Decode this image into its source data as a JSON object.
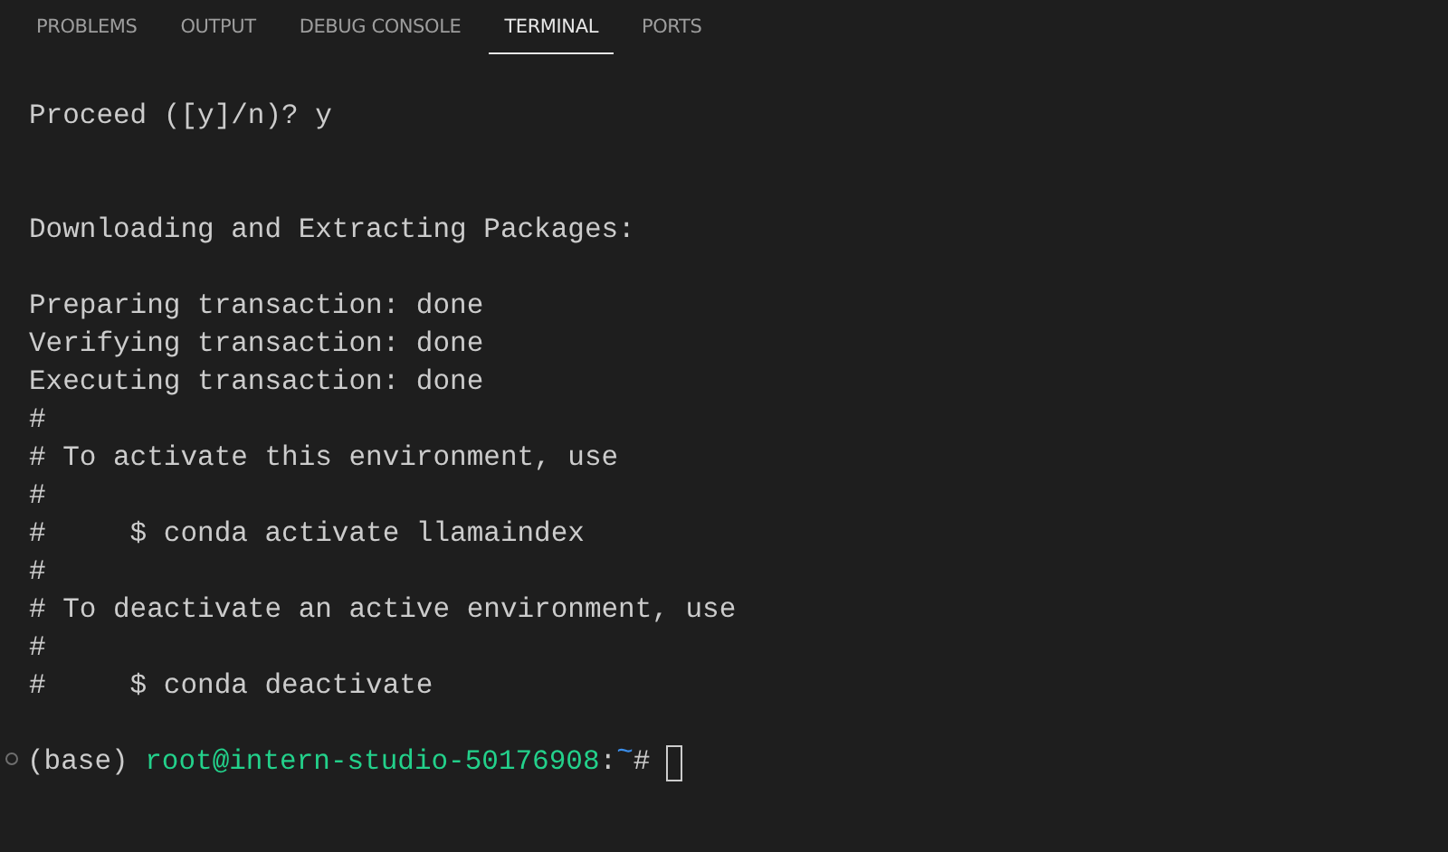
{
  "tabs": [
    {
      "label": "PROBLEMS",
      "selected": false
    },
    {
      "label": "OUTPUT",
      "selected": false
    },
    {
      "label": "DEBUG CONSOLE",
      "selected": false
    },
    {
      "label": "TERMINAL",
      "selected": true
    },
    {
      "label": "PORTS",
      "selected": false
    }
  ],
  "terminal": {
    "lines": [
      {
        "kind": "text",
        "text": "Proceed ([y]/n)? y"
      },
      {
        "kind": "blank"
      },
      {
        "kind": "blank"
      },
      {
        "kind": "text",
        "text": "Downloading and Extracting Packages:"
      },
      {
        "kind": "blank"
      },
      {
        "kind": "text",
        "text": "Preparing transaction: done"
      },
      {
        "kind": "text",
        "text": "Verifying transaction: done"
      },
      {
        "kind": "text",
        "text": "Executing transaction: done"
      },
      {
        "kind": "text",
        "text": "#"
      },
      {
        "kind": "text",
        "text": "# To activate this environment, use"
      },
      {
        "kind": "text",
        "text": "#"
      },
      {
        "kind": "text",
        "text": "#     $ conda activate llamaindex"
      },
      {
        "kind": "text",
        "text": "#"
      },
      {
        "kind": "text",
        "text": "# To deactivate an active environment, use"
      },
      {
        "kind": "text",
        "text": "#"
      },
      {
        "kind": "text",
        "text": "#     $ conda deactivate"
      },
      {
        "kind": "blank"
      }
    ],
    "prompt": {
      "env": "(base)",
      "user_host": "root@intern-studio-50176908",
      "separator": ":",
      "path": "~",
      "symbol": "#"
    }
  }
}
